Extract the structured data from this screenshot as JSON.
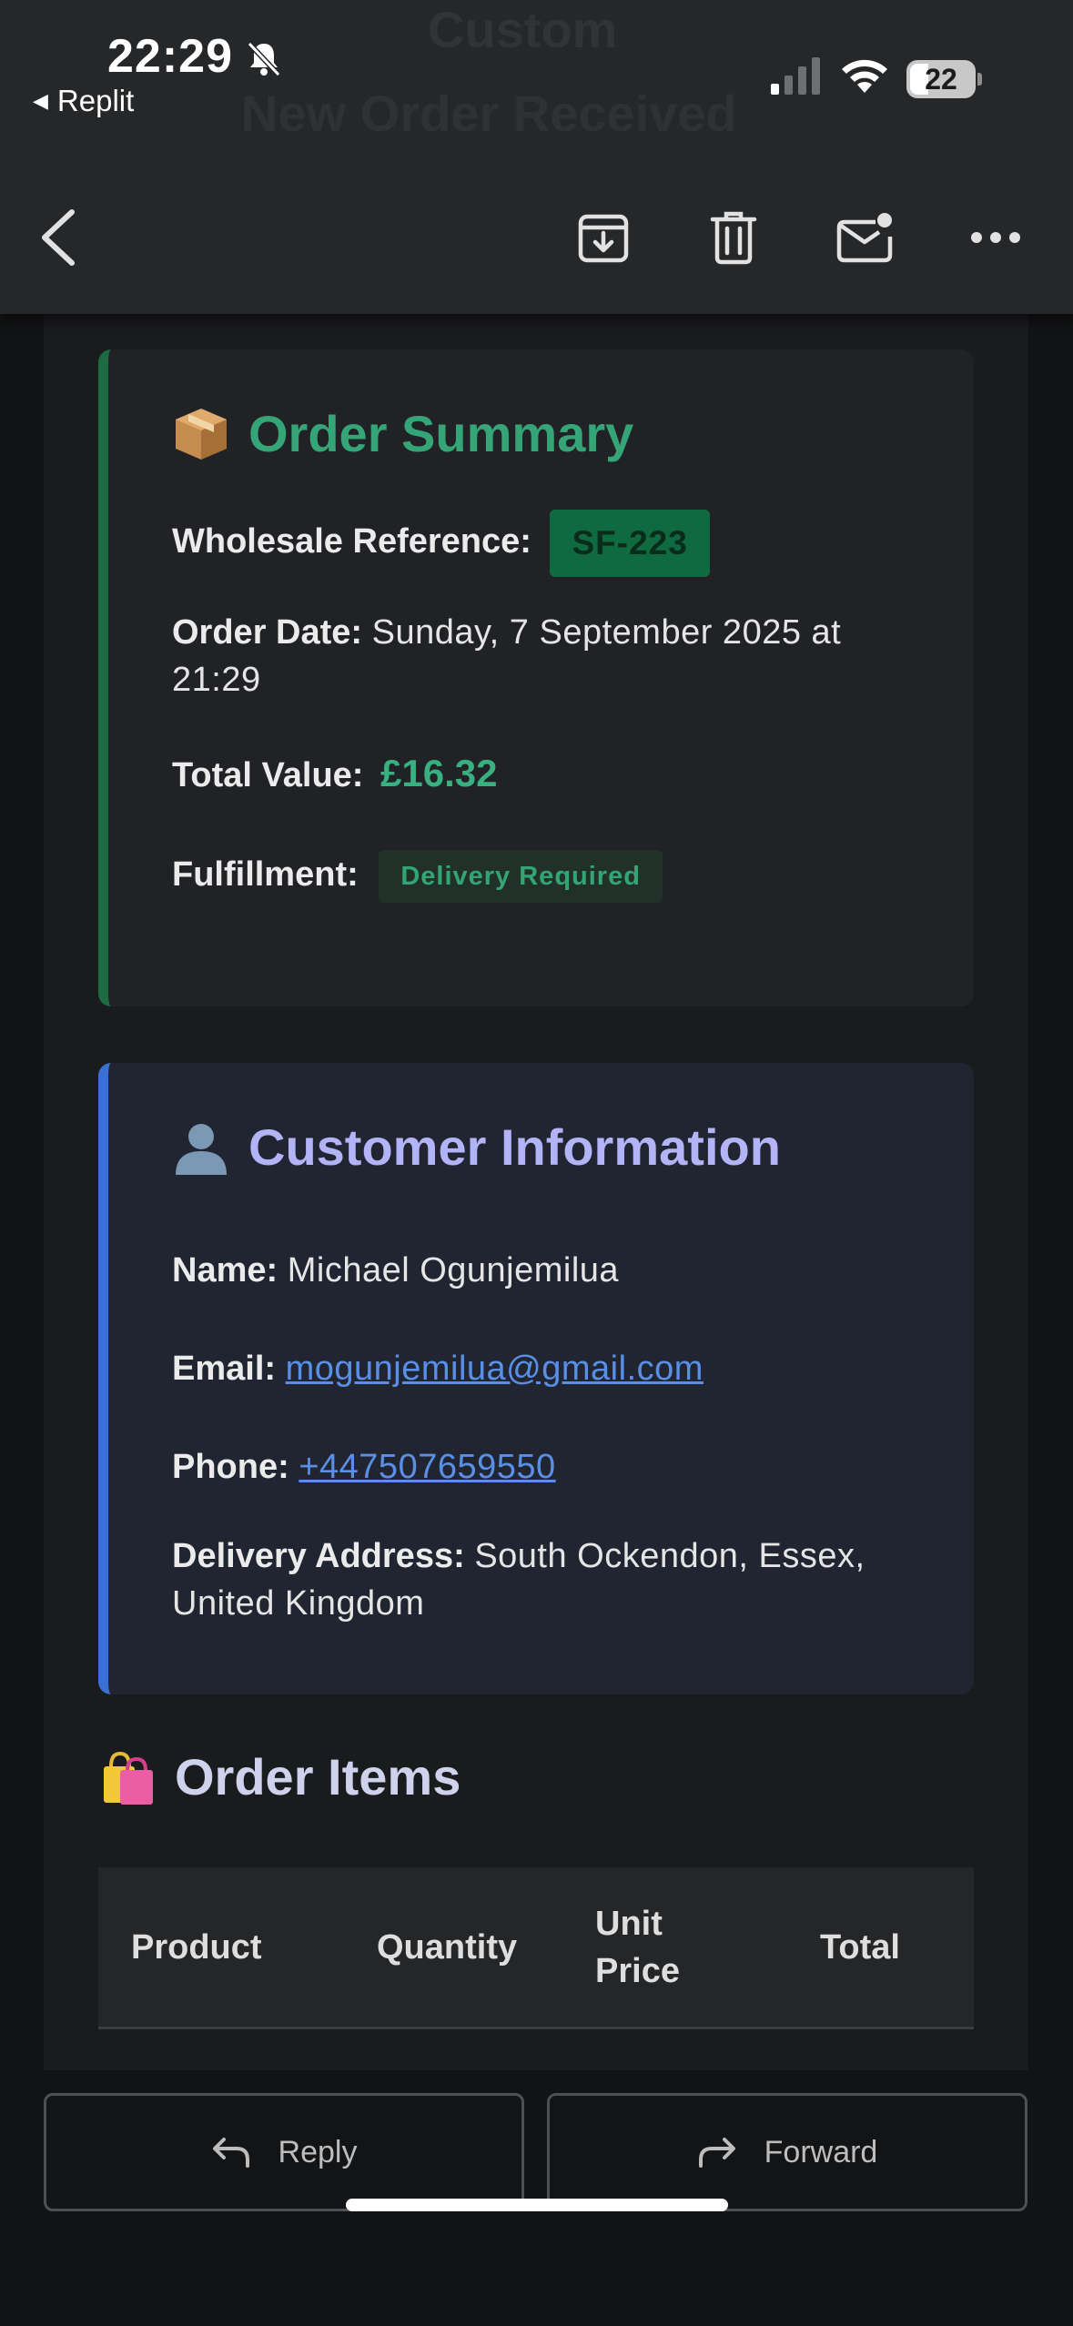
{
  "status_bar": {
    "time": "22:29",
    "back_app": "Replit",
    "battery": "22"
  },
  "background_ghost": {
    "line1": "Custom",
    "line2": "New Order Received"
  },
  "toolbar": {
    "icons": [
      "back-arrow-icon",
      "archive-icon",
      "trash-icon",
      "mark-unread-icon",
      "more-icon"
    ]
  },
  "order_summary": {
    "title": "Order Summary",
    "reference_label": "Wholesale Reference:",
    "reference_value": "SF-223",
    "date_label": "Order Date:",
    "date_value": "Sunday, 7 September 2025 at 21:29",
    "total_label": "Total Value:",
    "total_value": "£16.32",
    "fulfillment_label": "Fulfillment:",
    "fulfillment_value": "Delivery Required",
    "accent": "#35a577"
  },
  "customer": {
    "title": "Customer Information",
    "name_label": "Name:",
    "name_value": "Michael Ogunjemilua",
    "email_label": "Email:",
    "email_value": "mogunjemilua@gmail.com",
    "phone_label": "Phone:",
    "phone_value": "+447507659550",
    "address_label": "Delivery Address:",
    "address_value": "South Ockendon, Essex, United Kingdom",
    "accent": "#3a6fd6"
  },
  "order_items": {
    "title": "Order Items",
    "columns": [
      "Product",
      "Quantity",
      "Unit Price",
      "Total"
    ]
  },
  "actions": {
    "reply": "Reply",
    "forward": "Forward"
  }
}
